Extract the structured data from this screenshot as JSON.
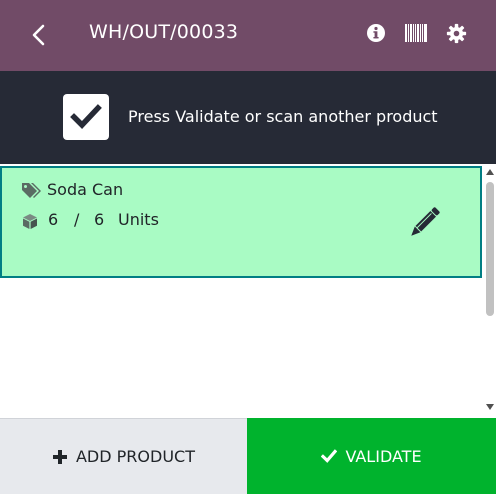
{
  "header": {
    "title": "WH/OUT/00033",
    "icons": [
      "back-arrow-icon",
      "info-icon",
      "barcode-icon",
      "gear-icon"
    ]
  },
  "banner": {
    "message": "Press Validate or scan another product",
    "checked": true
  },
  "lines": [
    {
      "product": "Soda Can",
      "qty_done": "6",
      "separator": "/",
      "qty_total": "6",
      "uom": "Units"
    }
  ],
  "footer": {
    "add_product_label": "ADD PRODUCT",
    "validate_label": "VALIDATE"
  },
  "colors": {
    "header_bg": "#714b67",
    "banner_bg": "#262a36",
    "line_bg": "#a9fbc4",
    "line_border": "#017e84",
    "validate_bg": "#00b32d",
    "add_bg": "#e7e9ed"
  }
}
